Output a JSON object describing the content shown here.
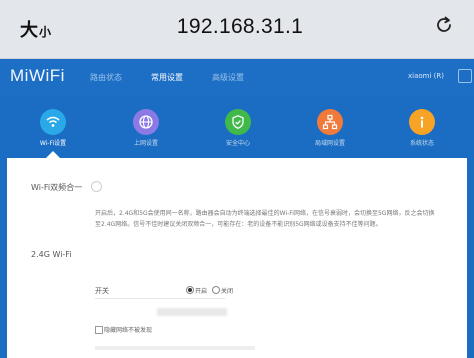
{
  "browser": {
    "text_size_big": "大",
    "text_size_small": "小",
    "url": "192.168.31.1"
  },
  "header": {
    "logo": "MiWiFi",
    "nav": [
      "路由状态",
      "常用设置",
      "高级设置"
    ],
    "active_nav": "常用设置",
    "user": "xiaomi (R)"
  },
  "icons": [
    {
      "name": "wifi-icon",
      "label": "Wi-Fi设置",
      "color": "#2aa8e8",
      "active": true
    },
    {
      "name": "globe-icon",
      "label": "上网设置",
      "color": "#8b7ae6",
      "active": false
    },
    {
      "name": "shield-icon",
      "label": "安全中心",
      "color": "#41b84a",
      "active": false
    },
    {
      "name": "network-icon",
      "label": "局域网设置",
      "color": "#f07a3a",
      "active": false
    },
    {
      "name": "info-icon",
      "label": "系统状态",
      "color": "#f7a325",
      "active": false
    }
  ],
  "content": {
    "section1": "Wi-Fi双频合一",
    "description": "开启后，2.4G和5G会使用同一名称，路由器会自动为终端选择最佳的Wi-Fi网络，在信号衰弱时，会切换至5G网络，反之会切换至2.4G网络。信号不佳时建议关闭双频合一，可能存在：老的设备不能识别5G网络或设备支持不佳等问题。",
    "section2": "2.4G Wi-Fi",
    "switch_label": "开关",
    "radio_on": "开启",
    "radio_off": "关闭",
    "hide_label": "隐藏网络不被发现"
  }
}
